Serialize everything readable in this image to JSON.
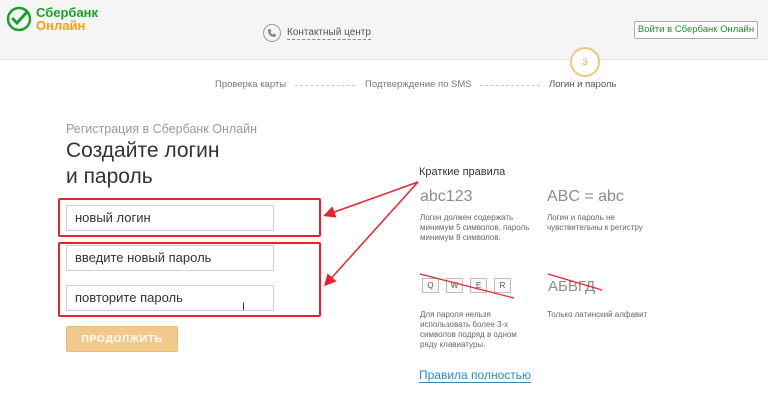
{
  "header": {
    "brand_line1": "Сбербанк",
    "brand_line2": "Онлайн",
    "contact_label": "Контактный центр",
    "login_button": "Войти в Сбербанк Онлайн"
  },
  "steps": {
    "step1": "Проверка карты",
    "step2": "Подтверждение по SMS",
    "step3": "Логин и пароль",
    "current_number": "3"
  },
  "form": {
    "subtitle": "Регистрация в Сбербанк Онлайн",
    "title_line1": "Создайте логин",
    "title_line2": "и пароль",
    "login_placeholder": "новый логин",
    "password_placeholder": "введите новый пароль",
    "repeat_placeholder": "повторите пароль",
    "continue_button": "ПРОДОЛЖИТЬ"
  },
  "rules": {
    "title": "Краткие правила",
    "rule1_example": "abc123",
    "rule1_text": "Логин должен содержать минимум 5 символов, пароль минимум 8 символов.",
    "rule2_example": "ABC = abc",
    "rule2_text": "Логин и пароль не чувствительны к регистру",
    "keys": [
      "Q",
      "W",
      "E",
      "R"
    ],
    "rule3_text": "Для пароля нельзя использовать более 3-х символов подряд в одном ряду клавиатуры.",
    "rule4_example": "АБВГД",
    "rule4_text": "Только латинский алфавит",
    "full_rules_link": "Правила полностью"
  },
  "colors": {
    "brand_green": "#1a9f29",
    "brand_orange": "#f2a20c",
    "highlight_red": "#e8232e",
    "link_blue": "#2a8cc4",
    "button_gold": "#f1c98a"
  }
}
